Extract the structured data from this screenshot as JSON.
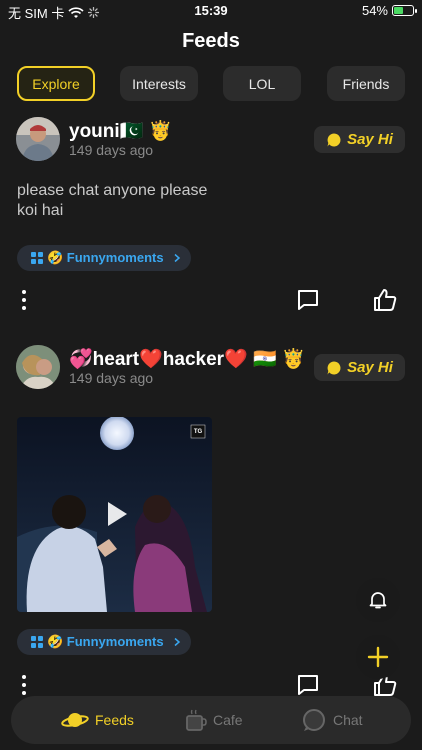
{
  "status_bar": {
    "carrier": "无 SIM 卡",
    "time": "15:39",
    "battery": "54%",
    "battery_level": 0.54
  },
  "header": {
    "title": "Feeds"
  },
  "tabs": [
    {
      "label": "Explore",
      "active": true
    },
    {
      "label": "Interests",
      "active": false
    },
    {
      "label": "LOL",
      "active": false
    },
    {
      "label": "Friends",
      "active": false
    }
  ],
  "posts": [
    {
      "username": "youni🇵🇰 🤴",
      "time_ago": "149 days ago",
      "say_hi": "Say Hi",
      "text": [
        "please chat anyone please",
        "koi hai"
      ],
      "topic": "🤣 Funnymoments"
    },
    {
      "username": "💞heart❤️hacker❤️ 🇮🇳 🤴",
      "time_ago": "149 days ago",
      "say_hi": "Say Hi",
      "video_badge": "TG",
      "topic": "🤣 Funnymoments"
    }
  ],
  "bottom_nav": [
    {
      "label": "Feeds",
      "active": true
    },
    {
      "label": "Cafe",
      "active": false
    },
    {
      "label": "Chat",
      "active": false
    }
  ],
  "colors": {
    "accent": "#f2d027",
    "topic": "#3aa7f0",
    "background": "#1b1b1b"
  }
}
